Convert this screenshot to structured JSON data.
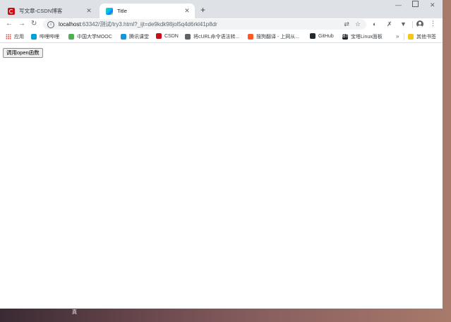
{
  "tabs": [
    {
      "title": "写文章-CSDN博客",
      "favicon": "csdn-icon",
      "active": false
    },
    {
      "title": "Title",
      "favicon": "jetbrains-icon",
      "active": true
    }
  ],
  "toolbar": {
    "url_host": "localhost",
    "url_path": ":63342/测试/try3.html?_ijt=de9kdk98jol5q4d6rkl41p8dr"
  },
  "bookmarks": [
    {
      "label": "应用",
      "icon": "apps-icon"
    },
    {
      "label": "哔哩哔哩",
      "icon": "bilibili-icon"
    },
    {
      "label": "中国大学MOOC",
      "icon": "mooc-icon"
    },
    {
      "label": "腾讯课堂",
      "icon": "tencent-icon"
    },
    {
      "label": "CSDN",
      "icon": "csdn-icon"
    },
    {
      "label": "将cURL命令语法转...",
      "icon": "globe-icon"
    },
    {
      "label": "搜狗翻译 - 上网从...",
      "icon": "sogou-icon"
    },
    {
      "label": "GitHub",
      "icon": "github-icon"
    },
    {
      "label": "宝塔Linux面板",
      "icon": "bt-icon"
    },
    {
      "label": "其他书签",
      "icon": "folder-icon"
    }
  ],
  "page": {
    "button_label": "调用open函数"
  },
  "taskbar": {
    "glyph": "真"
  },
  "colors": {
    "tabstrip": "#dee1e6",
    "omnibox": "#f1f3f4",
    "csdn_red": "#ca0c16"
  }
}
